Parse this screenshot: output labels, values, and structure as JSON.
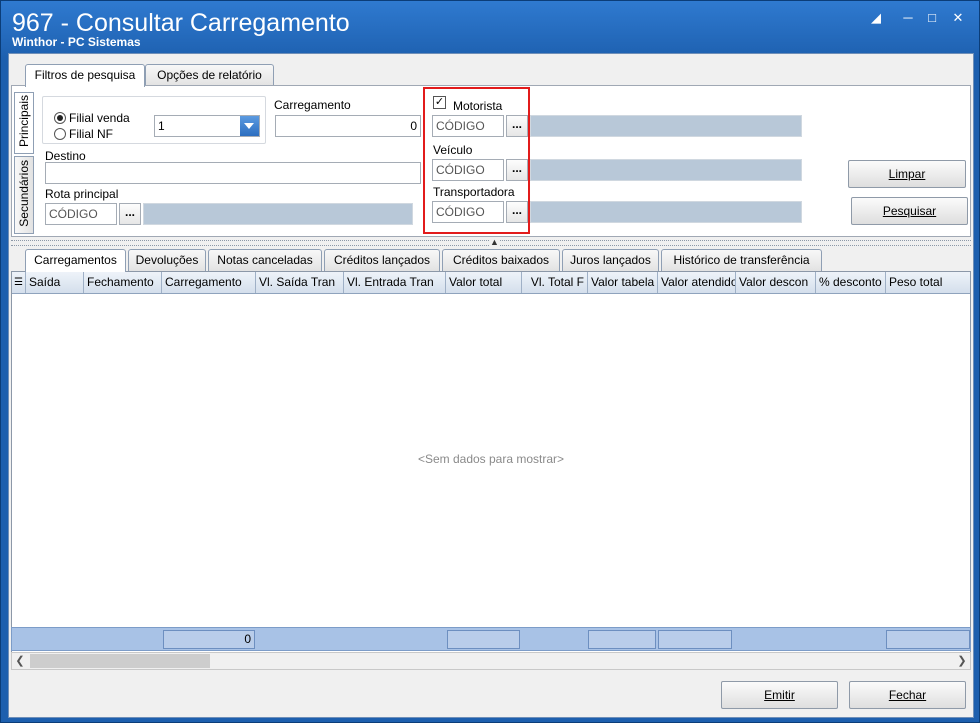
{
  "window": {
    "title": "967 - Consultar Carregamento",
    "subtitle": "Winthor - PC Sistemas"
  },
  "top_tabs": [
    "Filtros de pesquisa",
    "Opções de relatório"
  ],
  "side_tabs": [
    "Principais",
    "Secundários"
  ],
  "filters": {
    "filial_venda_label": "Filial venda",
    "filial_nf_label": "Filial NF",
    "filial_value": "1",
    "carregamento_label": "Carregamento",
    "carregamento_value": "0",
    "destino_label": "Destino",
    "rota_principal_label": "Rota principal",
    "rota_code_placeholder": "CÓDIGO",
    "motorista_label": "Motorista",
    "motorista_checked": true,
    "motorista_code_placeholder": "CÓDIGO",
    "veiculo_label": "Veículo",
    "veiculo_code_placeholder": "CÓDIGO",
    "transportadora_label": "Transportadora",
    "transportadora_code_placeholder": "CÓDIGO",
    "dots_label": "..."
  },
  "buttons": {
    "limpar": "Limpar",
    "pesquisar": "Pesquisar",
    "emitir": "Emitir",
    "fechar": "Fechar"
  },
  "bottom_tabs": [
    "Carregamentos",
    "Devoluções",
    "Notas canceladas",
    "Créditos lançados",
    "Créditos baixados",
    "Juros lançados",
    "Histórico de transferência"
  ],
  "grid": {
    "columns": [
      "Saída",
      "Fechamento",
      "Carregamento",
      "Vl. Saída Tran",
      "Vl. Entrada Tran",
      "Valor total",
      "Vl. Total F",
      "Valor tabela",
      "Valor atendido",
      "Valor descon",
      "% desconto",
      "Peso total"
    ],
    "empty_message": "<Sem dados para mostrar>",
    "footer_carregamento_total": "0"
  },
  "colors": {
    "highlight": "#e21b1b",
    "title_bar": "#1d5fae"
  }
}
